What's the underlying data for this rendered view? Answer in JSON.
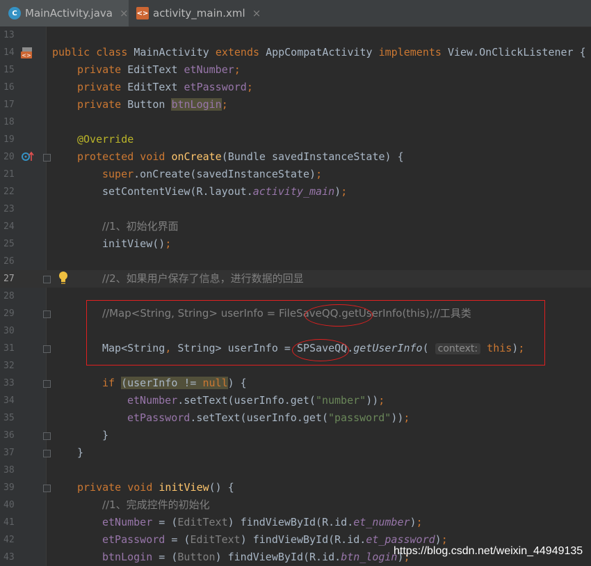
{
  "tabs": [
    {
      "label": "MainActivity.java",
      "icon": "java-class-icon",
      "active": true
    },
    {
      "label": "activity_main.xml",
      "icon": "xml-layout-icon",
      "active": false
    }
  ],
  "close_glyph": "×",
  "lines": {
    "n13": "13",
    "n14": "14",
    "n15": "15",
    "n16": "16",
    "n17": "17",
    "n18": "18",
    "n19": "19",
    "n20": "20",
    "n21": "21",
    "n22": "22",
    "n23": "23",
    "n24": "24",
    "n25": "25",
    "n26": "26",
    "n27": "27",
    "n28": "28",
    "n29": "29",
    "n30": "30",
    "n31": "31",
    "n32": "32",
    "n33": "33",
    "n34": "34",
    "n35": "35",
    "n36": "36",
    "n37": "37",
    "n38": "38",
    "n39": "39",
    "n40": "40",
    "n41": "41",
    "n42": "42",
    "n43": "43"
  },
  "code": {
    "l14": {
      "a": "public class ",
      "b": "MainActivity ",
      "c": "extends ",
      "d": "AppCompatActivity ",
      "e": "implements ",
      "f": "View.OnClickListener {"
    },
    "l15": {
      "a": "private ",
      "b": "EditText ",
      "c": "etNumber",
      "d": ";"
    },
    "l16": {
      "a": "private ",
      "b": "EditText ",
      "c": "etPassword",
      "d": ";"
    },
    "l17": {
      "a": "private ",
      "b": "Button ",
      "c": "btnLogin",
      "d": ";"
    },
    "l19": "@Override",
    "l20": {
      "a": "protected void ",
      "b": "onCreate",
      "c": "(Bundle savedInstanceState) {"
    },
    "l21": {
      "a": "super",
      "b": ".onCreate(savedInstanceState)",
      "c": ";"
    },
    "l22": {
      "a": "setContentView(R.layout.",
      "b": "activity_main",
      "c": ")",
      "d": ";"
    },
    "l24": "//1、初始化界面",
    "l25": {
      "a": "initView()",
      "b": ";"
    },
    "l27": "//2、如果用户保存了信息，进行数据的回显",
    "l29": {
      "a": "//Map<String, String> userInfo = ",
      "b": "FileSaveQQ",
      "c": ".getUserInfo(this);//工具类"
    },
    "l31": {
      "a": "Map<String",
      "b": ", ",
      "c": "String> userInfo = ",
      "d": "SPSaveQQ",
      "e": ".",
      "f": "getUserInfo",
      "g": "(",
      "hint": "context:",
      "h": "this",
      "i": ")",
      "j": ";"
    },
    "l33": {
      "a": "if ",
      "b": "(",
      "c": "userInfo != ",
      "d": "null",
      "e": ") {"
    },
    "l34": {
      "a": "etNumber",
      "b": ".setText(userInfo.get(",
      "c": "\"number\"",
      "d": "))",
      "e": ";"
    },
    "l35": {
      "a": "etPassword",
      "b": ".setText(userInfo.get(",
      "c": "\"password\"",
      "d": "))",
      "e": ";"
    },
    "l36": "}",
    "l37": "}",
    "l39": {
      "a": "private void ",
      "b": "initView",
      "c": "() {"
    },
    "l40": "//1、完成控件的初始化",
    "l41": {
      "a": "etNumber",
      "b": " = (",
      "c": "EditText",
      "d": ") findViewById(R.id.",
      "e": "et_number",
      "f": ")",
      "g": ";"
    },
    "l42": {
      "a": "etPassword",
      "b": " = (",
      "c": "EditText",
      "d": ") findViewById(R.id.",
      "e": "et_password",
      "f": ")",
      "g": ";"
    },
    "l43": {
      "a": "btnLogin",
      "b": " = (",
      "c": "Button",
      "d": ") findViewById(R.id.",
      "e": "btn_login",
      "f": ")",
      "g": ";"
    }
  },
  "watermark": "https://blog.csdn.net/weixin_44949135",
  "colors": {
    "keyword": "#cc7832",
    "field": "#9876aa",
    "method": "#ffc66d",
    "string": "#6a8759",
    "comment": "#808080",
    "annotation": "#bbb529",
    "highlight_box": "#e02020"
  }
}
